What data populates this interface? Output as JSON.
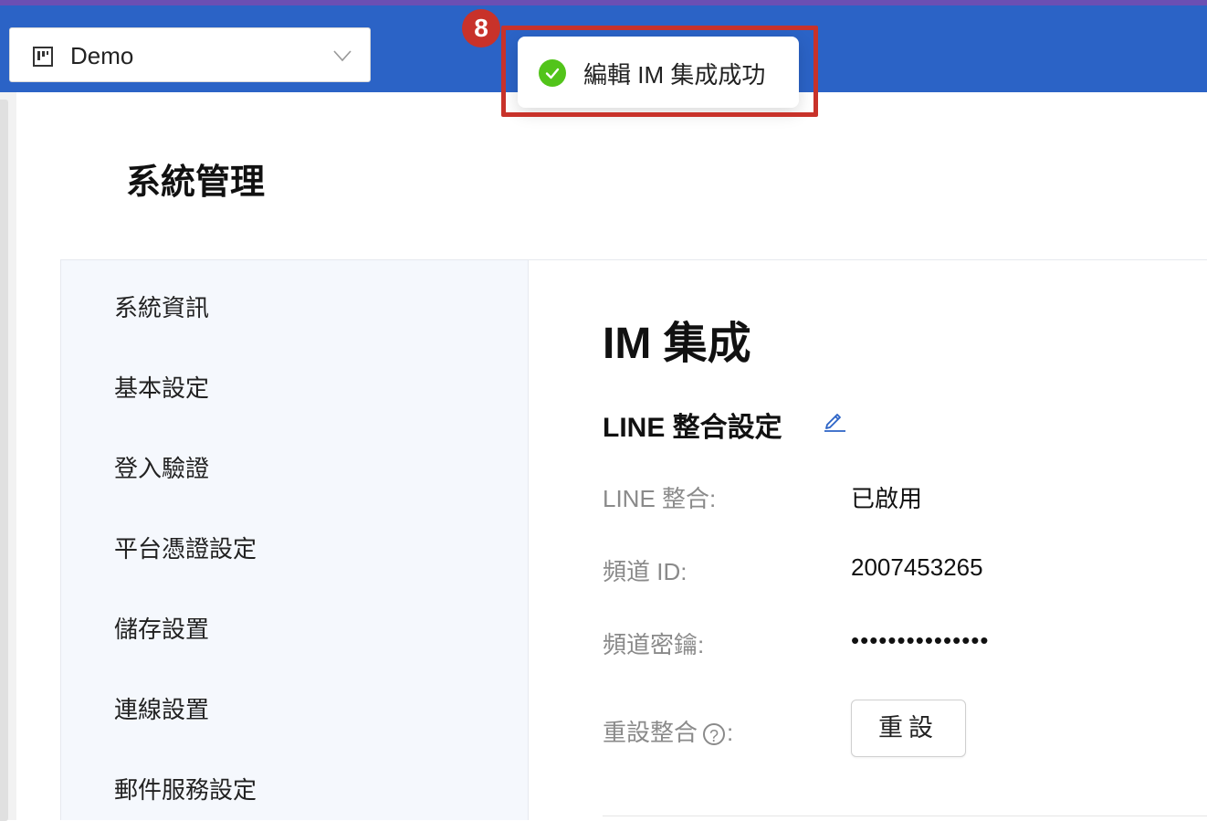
{
  "header": {
    "project_name": "Demo",
    "project_icon": "board-icon",
    "dropdown_icon": "chevron-down-icon"
  },
  "toast": {
    "message": "編輯 IM 集成成功",
    "icon": "check-circle-icon",
    "step_number": "8",
    "highlight_color": "#c8322a"
  },
  "page": {
    "title": "系統管理"
  },
  "sidebar": {
    "items": [
      {
        "label": "系統資訊"
      },
      {
        "label": "基本設定"
      },
      {
        "label": "登入驗證"
      },
      {
        "label": "平台憑證設定"
      },
      {
        "label": "儲存設置"
      },
      {
        "label": "連線設置"
      },
      {
        "label": "郵件服務設定"
      }
    ]
  },
  "main": {
    "title": "IM 集成",
    "section_title": "LINE 整合設定",
    "fields": {
      "line_integration": {
        "label": "LINE 整合:",
        "value": "已啟用"
      },
      "channel_id": {
        "label": "頻道 ID:",
        "value": "2007453265"
      },
      "channel_secret": {
        "label": "頻道密鑰:",
        "value": "•••••••••••••••"
      },
      "reset": {
        "label": "重設整合",
        "label_suffix": ":",
        "help": "?",
        "button": "重設"
      }
    }
  },
  "colors": {
    "topbar": "#2b63c6",
    "accent_purple": "#6b4fb3",
    "success": "#52c41a",
    "link": "#2b63c6"
  }
}
